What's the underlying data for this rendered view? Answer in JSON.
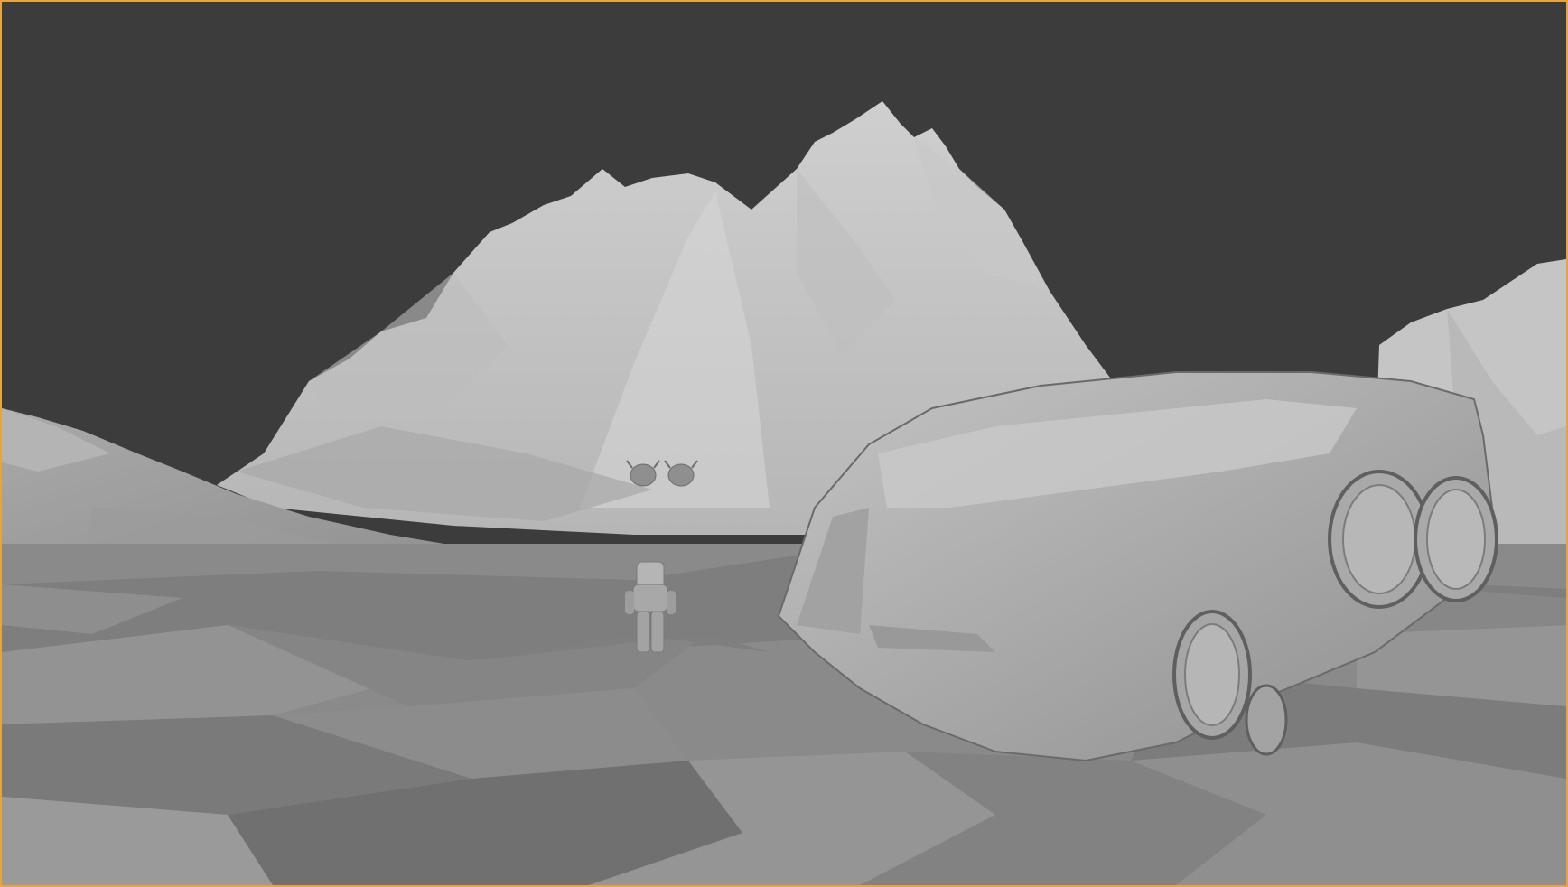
{
  "viewport": {
    "mode": "solid-shading",
    "active_outline_color": "#e8a33a",
    "background_color": "#3c3c3c"
  },
  "scene": {
    "objects": [
      {
        "name": "mountain-range-center",
        "icon": "terrain-mesh"
      },
      {
        "name": "mountain-range-left",
        "icon": "terrain-mesh"
      },
      {
        "name": "mountain-range-right",
        "icon": "terrain-mesh"
      },
      {
        "name": "ground-plane",
        "icon": "lowpoly-mesh"
      },
      {
        "name": "astronaut",
        "icon": "character-mesh"
      },
      {
        "name": "spaceship",
        "icon": "vehicle-mesh"
      },
      {
        "name": "creature-left",
        "icon": "creature-mesh"
      },
      {
        "name": "creature-right",
        "icon": "creature-mesh"
      }
    ]
  }
}
